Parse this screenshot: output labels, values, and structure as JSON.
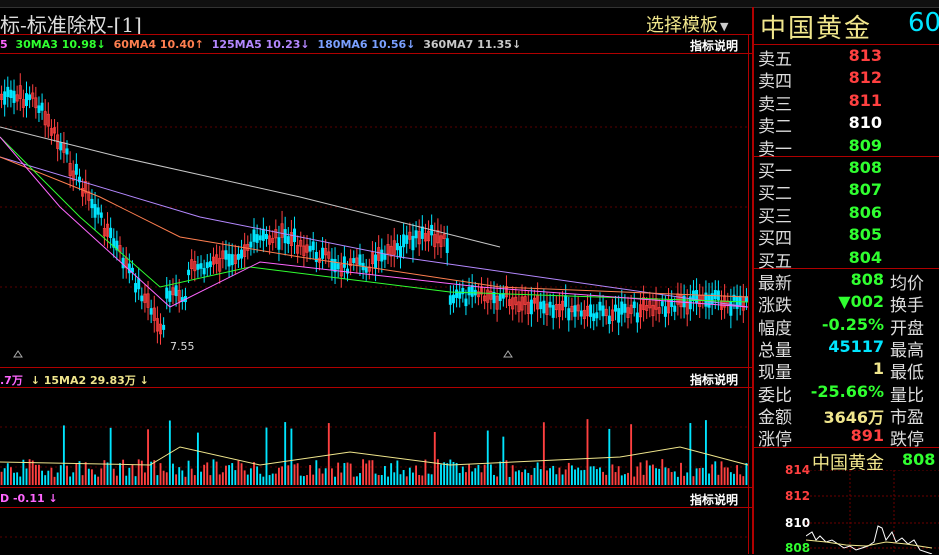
{
  "header": {
    "chart_title": "标-标准除权-[1]",
    "template_select_label": "选择模板"
  },
  "price_panel": {
    "ma_legend": [
      {
        "text": "5",
        "color": "#ff66ff"
      },
      {
        "text": "30MA3 10.98↓",
        "color": "#30ff30"
      },
      {
        "text": "60MA4 10.40↑",
        "color": "#ff7f50"
      },
      {
        "text": "125MA5 10.23↓",
        "color": "#b488ff"
      },
      {
        "text": "180MA6 10.56↓",
        "color": "#7aa0ff"
      },
      {
        "text": "360MA7 11.35↓",
        "color": "#c8c8c8"
      }
    ],
    "help_label": "指标说明",
    "low_label": "7.55"
  },
  "volume_panel": {
    "legend": [
      {
        "text": ".7万",
        "color": "#ff66ff"
      },
      {
        "text": "↓ 15MA2 29.83万 ↓",
        "color": "#f0e68c"
      }
    ],
    "help_label": "指标说明"
  },
  "indicator_panel": {
    "legend": [
      {
        "text": "D -0.11 ↓",
        "color": "#ff66ff"
      }
    ],
    "help_label": "指标说明"
  },
  "quote": {
    "name": "中国黄金",
    "code": "60",
    "asks": [
      {
        "label": "卖五",
        "price": "813",
        "color": "#ff4040"
      },
      {
        "label": "卖四",
        "price": "812",
        "color": "#ff4040"
      },
      {
        "label": "卖三",
        "price": "811",
        "color": "#ff4040"
      },
      {
        "label": "卖二",
        "price": "810",
        "color": "#ffffff"
      },
      {
        "label": "卖一",
        "price": "809",
        "color": "#30ff30"
      }
    ],
    "bids": [
      {
        "label": "买一",
        "price": "808",
        "color": "#30ff30"
      },
      {
        "label": "买二",
        "price": "807",
        "color": "#30ff30"
      },
      {
        "label": "买三",
        "price": "806",
        "color": "#30ff30"
      },
      {
        "label": "买四",
        "price": "805",
        "color": "#30ff30"
      },
      {
        "label": "买五",
        "price": "804",
        "color": "#30ff30"
      }
    ],
    "stats": [
      {
        "label": "最新",
        "value": "808",
        "color": "#30ff30",
        "side": "均价"
      },
      {
        "label": "涨跌",
        "value": "▼002",
        "color": "#30ff30",
        "side": "换手"
      },
      {
        "label": "幅度",
        "value": "-0.25%",
        "color": "#30ff30",
        "side": "开盘"
      },
      {
        "label": "总量",
        "value": "45117",
        "color": "#00e5ff",
        "side": "最高"
      },
      {
        "label": "现量",
        "value": "1",
        "color": "#f0e68c",
        "side": "最低"
      },
      {
        "label": "委比",
        "value": "-25.66%",
        "color": "#30ff30",
        "side": "量比"
      },
      {
        "label": "金额",
        "value": "3646万",
        "color": "#f0e68c",
        "side": "市盈"
      },
      {
        "label": "涨停",
        "value": "891",
        "color": "#ff4040",
        "side": "跌停"
      }
    ]
  },
  "mini_chart": {
    "title": "中国黄金",
    "price": "808",
    "ticks": [
      "814",
      "812",
      "810",
      "808"
    ]
  }
}
